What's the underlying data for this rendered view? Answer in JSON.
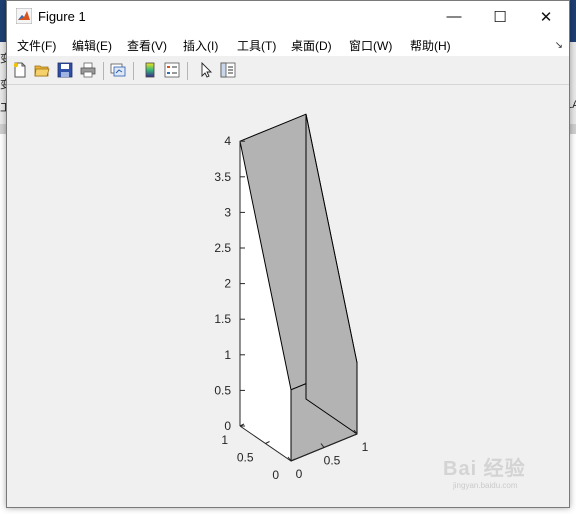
{
  "window": {
    "title": "Figure 1",
    "minimize_glyph": "—",
    "maximize_glyph": "☐",
    "close_glyph": "✕"
  },
  "menu": [
    {
      "label": "文件(F)"
    },
    {
      "label": "编辑(E)"
    },
    {
      "label": "查看(V)"
    },
    {
      "label": "插入(I)"
    },
    {
      "label": "工具(T)"
    },
    {
      "label": "桌面(D)"
    },
    {
      "label": "窗口(W)"
    },
    {
      "label": "帮助(H)"
    }
  ],
  "menu_dock_glyph": "↘",
  "toolbar": [
    "new-figure-icon",
    "open-file-icon",
    "save-icon",
    "print-icon",
    "link-plot-icon",
    "colorbar-icon",
    "legend-icon",
    "pointer-icon",
    "property-editor-icon"
  ],
  "background_glyphs": [
    "变",
    "变",
    "工",
    "LA"
  ],
  "chart_data": {
    "type": "3d-surface",
    "title": "",
    "xlabel": "",
    "ylabel": "",
    "zlabel": "",
    "z_ticks": [
      "0",
      "0.5",
      "1",
      "1.5",
      "2",
      "2.5",
      "3",
      "3.5",
      "4"
    ],
    "x_ticks": [
      "0",
      "0.5",
      "1"
    ],
    "y_ticks": [
      "0",
      "0.5",
      "1"
    ],
    "xlim": [
      0,
      1
    ],
    "ylim": [
      0,
      1
    ],
    "zlim": [
      0,
      4
    ],
    "faces": [
      {
        "name": "top",
        "vertices": [
          [
            0,
            0,
            1
          ],
          [
            1,
            0,
            1
          ],
          [
            1,
            1,
            4
          ],
          [
            0,
            1,
            4
          ]
        ]
      },
      {
        "name": "front",
        "vertices": [
          [
            0,
            0,
            0
          ],
          [
            1,
            0,
            0
          ],
          [
            1,
            0,
            1
          ],
          [
            0,
            0,
            1
          ]
        ]
      },
      {
        "name": "right",
        "vertices": [
          [
            1,
            0,
            0
          ],
          [
            1,
            1,
            0
          ],
          [
            1,
            1,
            4
          ],
          [
            1,
            0,
            1
          ]
        ]
      }
    ],
    "face_color": "#b3b3b3",
    "edge_color": "#000000",
    "axes_background": "#ffffff",
    "grid": false
  },
  "watermark": {
    "main": "Bai 经验",
    "sub": "jingyan.baidu.com"
  },
  "colors": {
    "window_bg": "#f0f0f0",
    "face": "#b3b3b3",
    "titlebar": "#ffffff"
  }
}
